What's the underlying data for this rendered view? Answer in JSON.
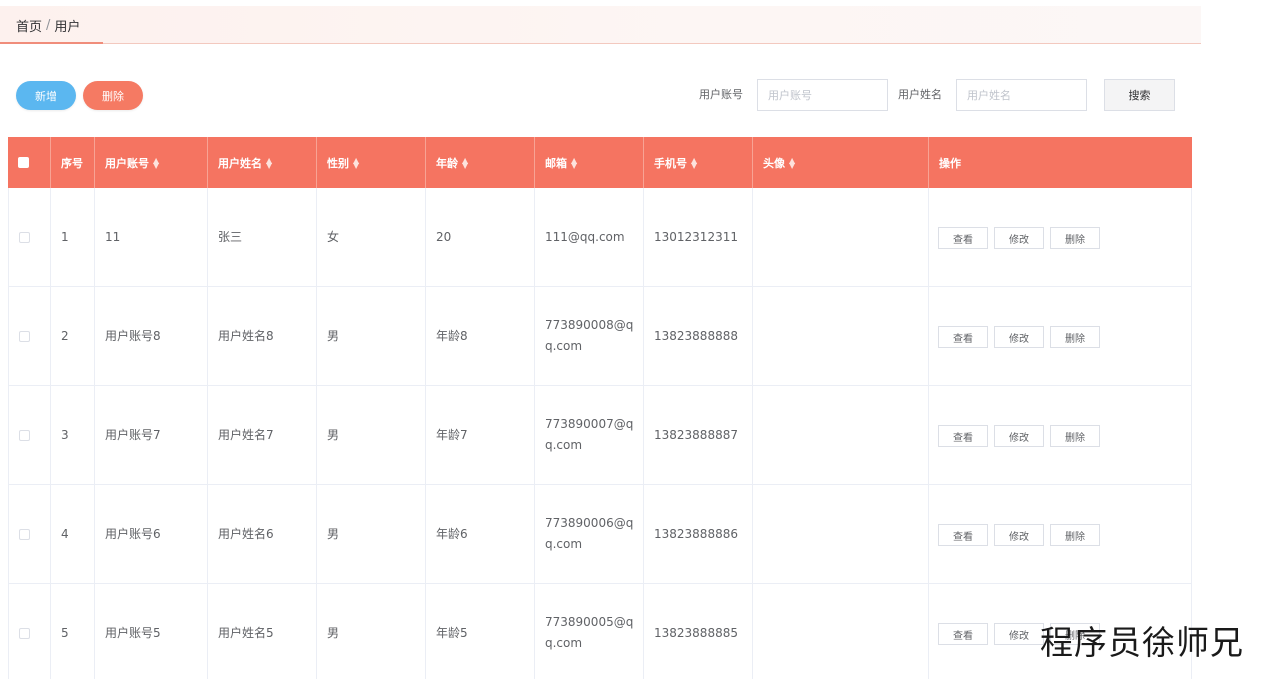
{
  "breadcrumb": {
    "home": "首页",
    "separator": "/",
    "current": "用户"
  },
  "toolbar": {
    "add_label": "新增",
    "delete_label": "删除"
  },
  "search": {
    "account_label": "用户账号",
    "account_placeholder": "用户账号",
    "name_label": "用户姓名",
    "name_placeholder": "用户姓名",
    "button_label": "搜索"
  },
  "table": {
    "headers": [
      "序号",
      "用户账号",
      "用户姓名",
      "性别",
      "年龄",
      "邮箱",
      "手机号",
      "头像",
      "操作"
    ],
    "actions": {
      "view": "查看",
      "edit": "修改",
      "delete": "删除"
    },
    "rows": [
      {
        "index": "1",
        "account": "11",
        "name": "张三",
        "gender": "女",
        "age": "20",
        "email": "111@qq.com",
        "phone": "13012312311",
        "avatar": ""
      },
      {
        "index": "2",
        "account": "用户账号8",
        "name": "用户姓名8",
        "gender": "男",
        "age": "年龄8",
        "email": "773890008@qq.com",
        "phone": "13823888888",
        "avatar": ""
      },
      {
        "index": "3",
        "account": "用户账号7",
        "name": "用户姓名7",
        "gender": "男",
        "age": "年龄7",
        "email": "773890007@qq.com",
        "phone": "13823888887",
        "avatar": ""
      },
      {
        "index": "4",
        "account": "用户账号6",
        "name": "用户姓名6",
        "gender": "男",
        "age": "年龄6",
        "email": "773890006@qq.com",
        "phone": "13823888886",
        "avatar": ""
      },
      {
        "index": "5",
        "account": "用户账号5",
        "name": "用户姓名5",
        "gender": "男",
        "age": "年龄5",
        "email": "773890005@qq.com",
        "phone": "13823888885",
        "avatar": ""
      }
    ]
  },
  "watermark": "程序员徐师兄",
  "colors": {
    "header_bg": "#f57461",
    "add_button": "#5bb7f0",
    "delete_button": "#f57a63",
    "breadcrumb_bg": "#fdf1ee"
  }
}
